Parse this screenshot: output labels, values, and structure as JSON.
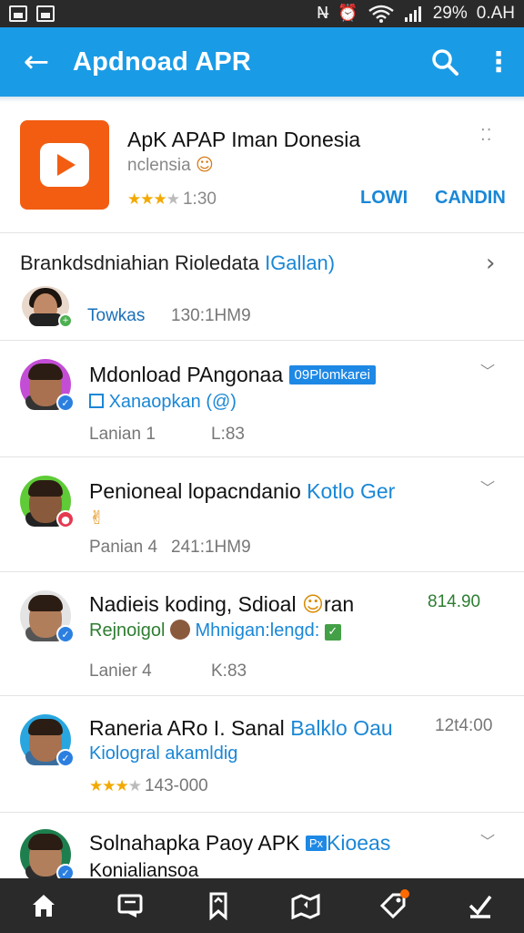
{
  "status_bar": {
    "icons_left": [
      "notification-square-icon",
      "image-icon"
    ],
    "icons_right": [
      "nfc-icon",
      "alarm-icon",
      "wifi-icon",
      "signal-icon"
    ],
    "battery": "29%",
    "time": "0.AH"
  },
  "app_bar": {
    "title": "Apdnoad APR",
    "icons": [
      "back-arrow-icon",
      "search-icon",
      "more-vert-icon"
    ],
    "color": "#1a9be6"
  },
  "featured_app": {
    "name": "ApK APAP Iman Donesia",
    "subtitle": "nclensia",
    "rating_text": "1:30",
    "stars": 3.5,
    "buttons": [
      "LOWI",
      "CANDIN"
    ],
    "icon_color": "#f25d12"
  },
  "section": {
    "title_main": "Brankdsdniahian Rioledata ",
    "title_highlight": "IGallan)",
    "meta_a": "Towkas",
    "meta_b": "130:1HM9"
  },
  "items": [
    {
      "title": "Mdonload PAngonaa ",
      "tag": "09Plomkarei",
      "sub": "Xanaopkan (@)",
      "foot_a": "Lanian 1",
      "foot_b": "L:83",
      "ring_color": "#c44dd6"
    },
    {
      "title": "Penioneal  lopacndanio ",
      "title_blue": "Kotlo Ger",
      "sub_emoji": "✌",
      "foot_a": "Panian 4",
      "foot_b": "241:1HM9",
      "ring_color": "#5ecb37"
    },
    {
      "title": "Nadieis koding, Sdioal ",
      "title_extra": "ran",
      "right": "814.90",
      "sub": "Rejnoigol",
      "sub2": "Mhnigan:lengd:",
      "foot_a": "Lanier 4",
      "foot_b": "K:83",
      "ring_color": "#dddddd"
    },
    {
      "title": "Raneria ARo I. Sanal ",
      "title_blue": "Balklo Oau",
      "right": "12t4:00",
      "sub": "Kiologral akamldig",
      "rating_text": "143-000",
      "stars": 3.5,
      "ring_color": "#29a6df"
    },
    {
      "title": "Solnahapka Paoy APK ",
      "tag": "Px",
      "title_blue": "Kioeas",
      "sub": "Konialiansoa",
      "ring_color": "#1d7f4d"
    }
  ],
  "bottom_nav": {
    "icons": [
      "home-icon",
      "messages-icon",
      "bookmark-icon",
      "map-icon",
      "tag-icon",
      "download-done-icon"
    ]
  }
}
